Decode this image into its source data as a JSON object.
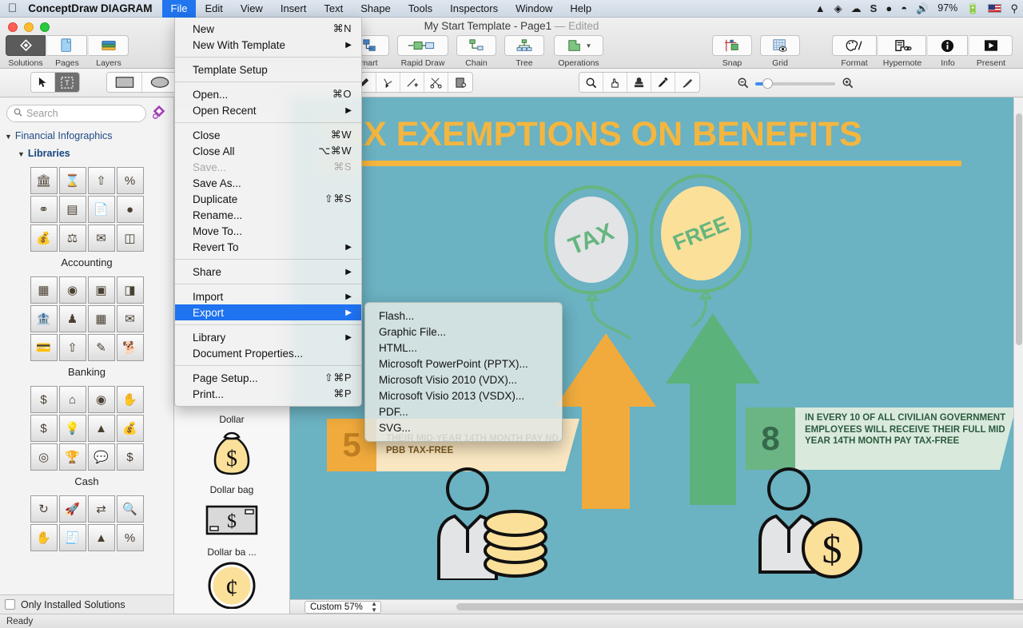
{
  "menubar": {
    "apple_icon": "apple-icon",
    "app_name": "ConceptDraw DIAGRAM",
    "items": [
      {
        "label": "File",
        "active": true
      },
      {
        "label": "Edit",
        "active": false
      },
      {
        "label": "View",
        "active": false
      },
      {
        "label": "Insert",
        "active": false
      },
      {
        "label": "Text",
        "active": false
      },
      {
        "label": "Shape",
        "active": false
      },
      {
        "label": "Tools",
        "active": false
      },
      {
        "label": "Inspectors",
        "active": false
      },
      {
        "label": "Window",
        "active": false
      },
      {
        "label": "Help",
        "active": false
      }
    ],
    "status": {
      "vlc_icon": "vlc-cone-icon",
      "dropbox_icon": "dropbox-icon",
      "cloud_icon": "cloud-upload-icon",
      "s_icon": "sublime-s-icon",
      "skype_icon": "skype-icon",
      "wifi_icon": "wifi-icon",
      "volume_icon": "volume-icon",
      "battery_pct": "97%",
      "battery_icon": "battery-charging-icon",
      "flag_icon": "us-flag-icon",
      "spotlight_icon": "spotlight-search-icon"
    }
  },
  "window": {
    "title": "My Start Template - Page1",
    "edited_label": "— Edited"
  },
  "toolbar": {
    "left_group": [
      {
        "label": "Solutions",
        "icon": "solutions-diamond-icon",
        "selected": true
      },
      {
        "label": "Pages",
        "icon": "pages-document-icon",
        "selected": false
      },
      {
        "label": "Layers",
        "icon": "layers-books-icon",
        "selected": false
      }
    ],
    "center_group": [
      {
        "label": "mart",
        "icon": "smart-connector-icon"
      },
      {
        "label": "Rapid Draw",
        "icon": "rapid-draw-icon"
      },
      {
        "label": "Chain",
        "icon": "chain-icon"
      },
      {
        "label": "Tree",
        "icon": "tree-icon"
      },
      {
        "label": "Operations",
        "icon": "operations-shape-icon"
      }
    ],
    "right_group_a": [
      {
        "label": "Snap",
        "icon": "snap-icon"
      },
      {
        "label": "Grid",
        "icon": "grid-eye-icon"
      }
    ],
    "right_group_b": [
      {
        "label": "Format",
        "icon": "format-palette-icon"
      },
      {
        "label": "Hypernote",
        "icon": "hypernote-icon"
      },
      {
        "label": "Info",
        "icon": "info-circle-icon"
      },
      {
        "label": "Present",
        "icon": "present-play-icon"
      }
    ]
  },
  "toolrow2": {
    "tools_left": [
      {
        "icon": "arrow-pointer-icon",
        "selected": false
      },
      {
        "icon": "text-box-icon",
        "selected": true
      }
    ],
    "shapes": [
      {
        "icon": "rectangle-icon"
      },
      {
        "icon": "ellipse-icon"
      }
    ],
    "pen_tools": [
      {
        "icon": "pen-icon"
      },
      {
        "icon": "polyline-node-icon"
      },
      {
        "icon": "add-point-icon"
      },
      {
        "icon": "scissors-cut-icon"
      },
      {
        "icon": "duplicate-shape-icon"
      }
    ],
    "view_tools": [
      {
        "icon": "magnifier-icon"
      },
      {
        "icon": "hand-pan-icon"
      },
      {
        "icon": "stamp-icon"
      },
      {
        "icon": "eyedropper-icon"
      },
      {
        "icon": "paint-brush-icon"
      }
    ],
    "zoom_out_icon": "zoom-out-icon",
    "zoom_in_icon": "zoom-in-icon",
    "zoom_slider_value": 18
  },
  "sidebar": {
    "search": {
      "placeholder": "Search",
      "value": "",
      "icon": "search-icon"
    },
    "favorite_icon": "solution-park-icon",
    "tree": [
      {
        "label": "Financial Infographics",
        "level": 1,
        "expanded": true
      },
      {
        "label": "Libraries",
        "level": 2,
        "expanded": true
      }
    ],
    "libraries": [
      {
        "name": "Accounting",
        "icons": [
          "bank-building-icon",
          "hourglass-coin-icon",
          "cash-arrow-up-icon",
          "percent-calculator-icon",
          "balloons-percent-icon",
          "calculator-coins-icon",
          "tax-document-icon",
          "coins-stack-icon",
          "tax-money-bag-icon",
          "scales-balance-icon",
          "envelope-document-icon",
          "tax-bars-icon"
        ]
      },
      {
        "name": "Banking",
        "icons": [
          "atm-machine-icon",
          "hand-coin-icon",
          "safe-vault-icon",
          "gold-bars-icon",
          "mobile-bank-icon",
          "teller-person-icon",
          "bank-counter-icon",
          "envelope-money-icon",
          "card-shield-icon",
          "coins-arrow-up-icon",
          "cheque-pen-icon",
          "piggy-bank-icon"
        ]
      },
      {
        "name": "Cash",
        "icons": [
          "dollar-bill-icon",
          "house-dollar-icon",
          "dollar-coins-icon",
          "hand-dollar-icon",
          "dollar-badge-icon",
          "lightbulb-dollar-icon",
          "coin-tree-icon",
          "money-bag-dollar-icon",
          "coins-stack-cash-icon",
          "trophy-coin-icon",
          "speech-dollar-icon",
          "dollar-tag-icon"
        ]
      },
      {
        "name": "",
        "icons": [
          "coin-cycle-icon",
          "rocket-icon",
          "money-flow-icon",
          "dollar-search-icon",
          "hand-money-icon",
          "receipt-icon",
          "market-stall-icon",
          "percent-coins-icon"
        ]
      }
    ],
    "only_installed": {
      "label": "Only Installed Solutions",
      "checked": false
    }
  },
  "shapes_panel": {
    "items": [
      {
        "label": "Dollar",
        "icon": "dollar-coin-shape",
        "truncated": false
      },
      {
        "label": "Dollar bag",
        "icon": "dollar-bag-shape",
        "truncated": false
      },
      {
        "label": "Dollar ba ...",
        "icon": "dollar-banknote-shape",
        "truncated": true
      },
      {
        "label": "",
        "icon": "cent-coin-shape",
        "truncated": false
      }
    ]
  },
  "file_menu": {
    "sections": [
      [
        {
          "label": "New",
          "key": "⌘N",
          "submenu": false,
          "disabled": false,
          "highlight": false
        },
        {
          "label": "New With Template",
          "key": "",
          "submenu": true,
          "disabled": false,
          "highlight": false
        }
      ],
      [
        {
          "label": "Template Setup",
          "key": "",
          "submenu": false,
          "disabled": false,
          "highlight": false
        }
      ],
      [
        {
          "label": "Open...",
          "key": "⌘O",
          "submenu": false,
          "disabled": false,
          "highlight": false
        },
        {
          "label": "Open Recent",
          "key": "",
          "submenu": true,
          "disabled": false,
          "highlight": false
        }
      ],
      [
        {
          "label": "Close",
          "key": "⌘W",
          "submenu": false,
          "disabled": false,
          "highlight": false
        },
        {
          "label": "Close All",
          "key": "⌥⌘W",
          "submenu": false,
          "disabled": false,
          "highlight": false
        },
        {
          "label": "Save...",
          "key": "⌘S",
          "submenu": false,
          "disabled": true,
          "highlight": false
        },
        {
          "label": "Save As...",
          "key": "",
          "submenu": false,
          "disabled": false,
          "highlight": false
        },
        {
          "label": "Duplicate",
          "key": "⇧⌘S",
          "submenu": false,
          "disabled": false,
          "highlight": false
        },
        {
          "label": "Rename...",
          "key": "",
          "submenu": false,
          "disabled": false,
          "highlight": false
        },
        {
          "label": "Move To...",
          "key": "",
          "submenu": false,
          "disabled": false,
          "highlight": false
        },
        {
          "label": "Revert To",
          "key": "",
          "submenu": true,
          "disabled": false,
          "highlight": false
        }
      ],
      [
        {
          "label": "Share",
          "key": "",
          "submenu": true,
          "disabled": false,
          "highlight": false
        }
      ],
      [
        {
          "label": "Import",
          "key": "",
          "submenu": true,
          "disabled": false,
          "highlight": false
        },
        {
          "label": "Export",
          "key": "",
          "submenu": true,
          "disabled": false,
          "highlight": true
        }
      ],
      [
        {
          "label": "Library",
          "key": "",
          "submenu": true,
          "disabled": false,
          "highlight": false
        },
        {
          "label": "Document Properties...",
          "key": "",
          "submenu": false,
          "disabled": false,
          "highlight": false
        }
      ],
      [
        {
          "label": "Page Setup...",
          "key": "⇧⌘P",
          "submenu": false,
          "disabled": false,
          "highlight": false
        },
        {
          "label": "Print...",
          "key": "⌘P",
          "submenu": false,
          "disabled": false,
          "highlight": false
        }
      ]
    ]
  },
  "export_submenu": {
    "items": [
      {
        "label": "Flash..."
      },
      {
        "label": "Graphic File..."
      },
      {
        "label": "HTML..."
      },
      {
        "label": "Microsoft PowerPoint (PPTX)..."
      },
      {
        "label": "Microsoft Visio 2010 (VDX)..."
      },
      {
        "label": "Microsoft Visio 2013 (VSDX)..."
      },
      {
        "label": "PDF..."
      },
      {
        "label": "SVG..."
      }
    ]
  },
  "canvas": {
    "background_color": "#6bb2c2",
    "title": "TAX EXEMPTIONS ON BENEFITS",
    "title_color": "#f4b63f",
    "balloons": [
      {
        "text": "TAX",
        "fill": "#e3e4e6",
        "outline": "#66b57f"
      },
      {
        "text": "FREE",
        "fill": "#fbe09a",
        "outline": "#66b57f"
      }
    ],
    "arrows": [
      {
        "color": "#f0ab3c",
        "name": "orange-up-arrow"
      },
      {
        "color": "#5cb27b",
        "name": "green-up-arrow"
      }
    ],
    "banners": [
      {
        "number": "5",
        "text": "POSITIONS WILL RECEIVE BOTH THEIR MID-YEAR 14TH MONTH PAY ND PBB TAX-FREE",
        "visible_text": "THEIR MID-YEAR 14TH MONTH PAY ND PBB TAX-FREE",
        "tab_color": "#f0ab3c",
        "body_color": "#fae7c2",
        "text_color": "#7c5a20"
      },
      {
        "number": "8",
        "text": "IN EVERY 10 OF ALL CIVILIAN GOVERNMENT EMPLOYEES WILL RECEIVE THEIR FULL MID YEAR 14TH MONTH PAY TAX-FREE",
        "visible_text": "IN EVERY 10 OF ALL CIVILIAN GOVERNMENT EMPLOYEES WILL RECEIVE THEIR FULL MID YEAR 14TH MONTH PAY TAX-FREE",
        "tab_color": "#6ab583",
        "body_color": "#d9eadd",
        "text_color": "#2c5b3d"
      }
    ],
    "people": [
      {
        "name": "person-with-coin-stack",
        "coin_color": "#fbe09a"
      },
      {
        "name": "person-with-dollar-coin",
        "coin_color": "#fbe09a"
      }
    ]
  },
  "zoombar": {
    "zoom_label": "Custom 57%",
    "stepper_icon": "stepper-up-down-icon"
  },
  "statusbar": {
    "text": "Ready"
  }
}
